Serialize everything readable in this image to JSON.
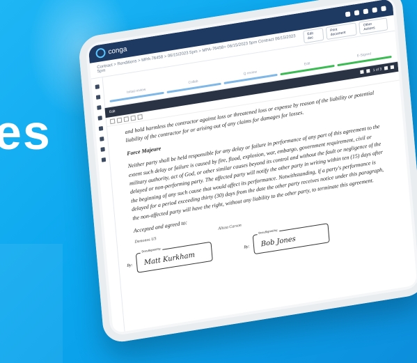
{
  "background": {
    "headline_fragment": "es",
    "accent_color": "#0aa6ee"
  },
  "app": {
    "logo_text": "conga",
    "breadcrumb": "Contract > Renditions > MPA-76458 > 06/15/2023 5pm > MPA-76458+ 06/15/2023 5pm Contract 06/15/2023 5pm",
    "actions": [
      "Edit doc",
      "Print document",
      "Other Actions"
    ]
  },
  "stages": [
    "Initial review",
    "Collab",
    "Q review",
    "Edit",
    "E-Signed"
  ],
  "viewer": {
    "page_indicator": "1 of 3",
    "mode_label": "Edit"
  },
  "document": {
    "intro": "and hold harmless the contractor against loss or threatened loss or expense by reason of the liability or potential liability of the contractor for or arising out of any claims for damages for losses.",
    "section_title": "Force Majeure",
    "section_body": "Neither party shall be held responsible for any delay or failure in performance of any part of this agreement to the extent such delay or failure is caused by fire, flood, explosion, war, embargo, government requirement, civil or military authority, act of God, or other similar causes beyond its control and without the fault or negligence of the delayed or non-performing party. The affected party will notify the other party in writing within ten (15) days after the beginning of any such cause that would affect its performance. Notwithstanding, if a party's performance is delayed for a period exceeding thirty (30) days from the date the other party receives notice under this paragraph, the non-affected party will have the right, without any liability to the other party, to terminate this agreement.",
    "accepted": "Accepted and agreed to:",
    "party_left": "Demonos US",
    "party_right": "Alissa Carson",
    "signatures": [
      {
        "by_label": "By:",
        "tag": "DocuSigned by:",
        "signature": "Matt Kurkham"
      },
      {
        "by_label": "By:",
        "tag": "DocuSigned by:",
        "signature": "Bob Jones"
      }
    ]
  }
}
